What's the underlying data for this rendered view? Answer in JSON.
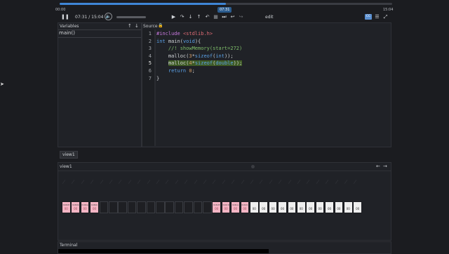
{
  "player": {
    "time_start": "00:00",
    "time_end": "15:04",
    "time_display": "07:31 / 15:04",
    "bubble": "07:31",
    "progress": 0.5,
    "edit_label": "edit",
    "cc_label": "CC"
  },
  "variables": {
    "title": "Variables",
    "items": [
      "main()"
    ]
  },
  "source": {
    "title": "Source",
    "line_numbers": [
      "1",
      "2",
      "3",
      "4",
      "5",
      "6",
      "7"
    ],
    "active_line": 5
  },
  "view_tab": "view1",
  "view_panel": {
    "title": "view1"
  },
  "memory": {
    "cells": [
      {
        "color": "pink",
        "a": "0x6b8",
        "v": "00"
      },
      {
        "color": "pink",
        "a": "0x6b9",
        "v": "00"
      },
      {
        "color": "pink",
        "a": "0x6ba",
        "v": "00"
      },
      {
        "color": "pink",
        "a": "0x6bb",
        "v": "00"
      },
      {
        "color": "dark",
        "a": "",
        "v": ""
      },
      {
        "color": "dark",
        "a": "",
        "v": ""
      },
      {
        "color": "dark",
        "a": "",
        "v": ""
      },
      {
        "color": "dark",
        "a": "",
        "v": ""
      },
      {
        "color": "dark",
        "a": "",
        "v": ""
      },
      {
        "color": "dark",
        "a": "",
        "v": ""
      },
      {
        "color": "dark",
        "a": "",
        "v": ""
      },
      {
        "color": "dark",
        "a": "",
        "v": ""
      },
      {
        "color": "dark",
        "a": "",
        "v": ""
      },
      {
        "color": "dark",
        "a": "",
        "v": ""
      },
      {
        "color": "dark",
        "a": "",
        "v": ""
      },
      {
        "color": "dark",
        "a": "",
        "v": ""
      },
      {
        "color": "pink",
        "a": "0x6c8",
        "v": "00"
      },
      {
        "color": "pink",
        "a": "0x6c9",
        "v": "00"
      },
      {
        "color": "pink",
        "a": "0x6ca",
        "v": "00"
      },
      {
        "color": "pink",
        "a": "0x6cb",
        "v": "00"
      },
      {
        "color": "light",
        "a": "",
        "v": "00"
      },
      {
        "color": "light",
        "a": "",
        "v": "00"
      },
      {
        "color": "light",
        "a": "",
        "v": "00"
      },
      {
        "color": "light",
        "a": "",
        "v": "00"
      },
      {
        "color": "light",
        "a": "",
        "v": "00"
      },
      {
        "color": "light",
        "a": "",
        "v": "00"
      },
      {
        "color": "light",
        "a": "",
        "v": "00"
      },
      {
        "color": "light",
        "a": "",
        "v": "00"
      },
      {
        "color": "light",
        "a": "",
        "v": "00"
      },
      {
        "color": "light",
        "a": "",
        "v": "00"
      },
      {
        "color": "light",
        "a": "",
        "v": "00"
      },
      {
        "color": "light",
        "a": "",
        "v": "00"
      }
    ],
    "colors": {
      "pink": "#f4b5c4",
      "dark": "#1e1f23",
      "light": "#eeeeee"
    }
  },
  "terminal": {
    "title": "Terminal"
  }
}
